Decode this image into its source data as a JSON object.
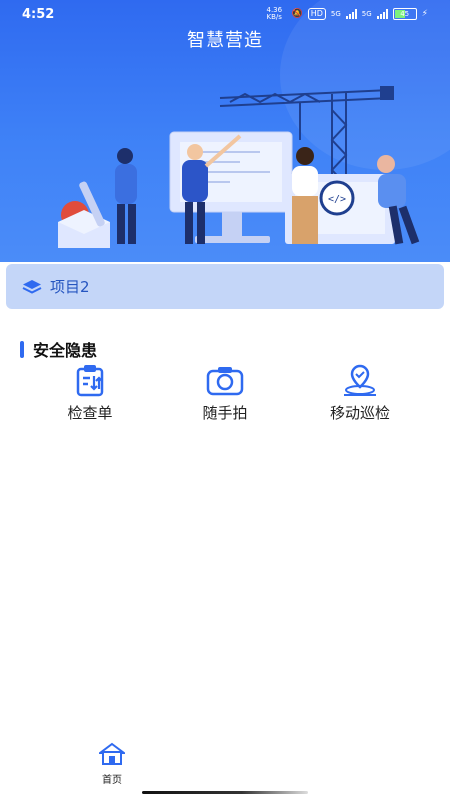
{
  "status_bar": {
    "time": "4:52",
    "net_speed": "4.36 KB/s",
    "hd_label": "HD",
    "net_5g_1": "5G",
    "net_5g_2": "5G",
    "battery": "45"
  },
  "header": {
    "title": "智慧营造"
  },
  "project": {
    "name": "项目2",
    "icon": "layers-icon"
  },
  "section": {
    "title": "安全隐患",
    "accent": "#2f6af0"
  },
  "actions": [
    {
      "label": "检查单",
      "icon": "checklist-icon"
    },
    {
      "label": "随手拍",
      "icon": "camera-icon"
    },
    {
      "label": "移动巡检",
      "icon": "location-patrol-icon"
    }
  ],
  "tabbar": {
    "items": [
      {
        "label": "首页",
        "icon": "home-icon"
      }
    ]
  },
  "colors": {
    "primary": "#2f6af0",
    "card_bg": "#c4d6f8",
    "card_text": "#2555c0"
  }
}
